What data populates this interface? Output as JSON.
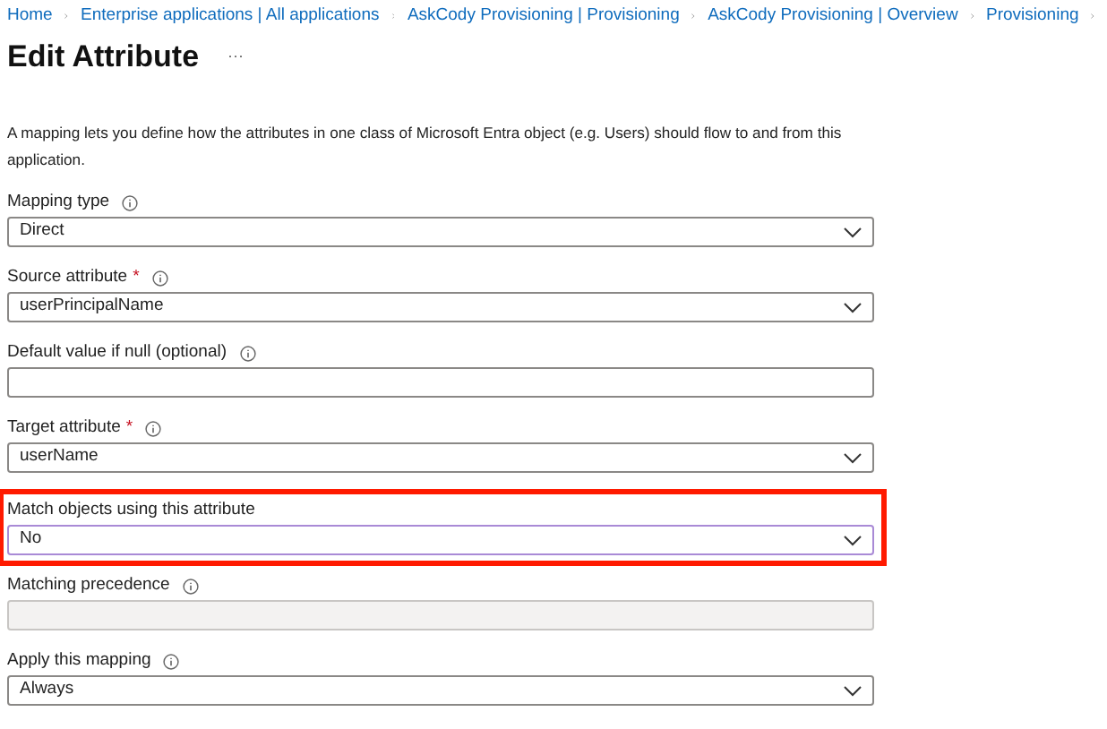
{
  "breadcrumb": [
    "Home",
    "Enterprise applications | All applications",
    "AskCody Provisioning | Provisioning",
    "AskCody Provisioning | Overview",
    "Provisioning"
  ],
  "title": "Edit Attribute",
  "more_menu": "···",
  "description": "A mapping lets you define how the attributes in one class of Microsoft Entra object (e.g. Users) should flow to and from this application.",
  "fields": [
    {
      "label": "Mapping type",
      "info": true,
      "kind": "dropdown",
      "value": "Direct",
      "highlighted": false
    },
    {
      "label": "Source attribute",
      "required_mark": "*",
      "info": true,
      "kind": "dropdown",
      "value": "userPrincipalName",
      "highlighted": false
    },
    {
      "label": "Default value if null (optional)",
      "info": true,
      "kind": "text",
      "highlighted": false
    },
    {
      "label": "Target attribute",
      "required_mark": "*",
      "info": true,
      "kind": "dropdown",
      "value": "userName",
      "highlighted": false
    },
    {
      "label": "Match objects using this attribute",
      "info": false,
      "kind": "dropdown",
      "value": "No",
      "highlighted": true
    },
    {
      "label": "Matching precedence",
      "info": true,
      "kind": "disabled",
      "highlighted": false
    },
    {
      "label": "Apply this mapping",
      "info": true,
      "kind": "dropdown",
      "value": "Always",
      "highlighted": false
    }
  ]
}
